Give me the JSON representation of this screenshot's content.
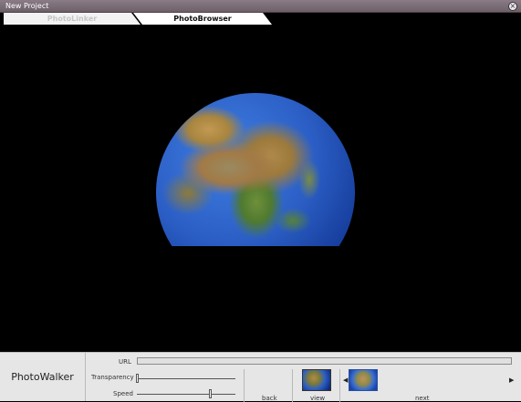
{
  "window": {
    "title": "New Project",
    "close_glyph": "×"
  },
  "tabs": [
    {
      "label": "PhotoLinker",
      "active": false
    },
    {
      "label": "PhotoBrowser",
      "active": true
    }
  ],
  "viewer": {
    "image": "globe-asia-icon"
  },
  "panel": {
    "brand": "PhotoWalker",
    "url_label": "URL",
    "url_value": "",
    "transparency_label": "Transparency",
    "speed_label": "Speed",
    "transparency_level": 0.0,
    "speed_level": 0.75,
    "back_label": "back",
    "view_label": "view",
    "next_label": "next",
    "prev_arrow": "◀",
    "next_arrow": "▶"
  }
}
